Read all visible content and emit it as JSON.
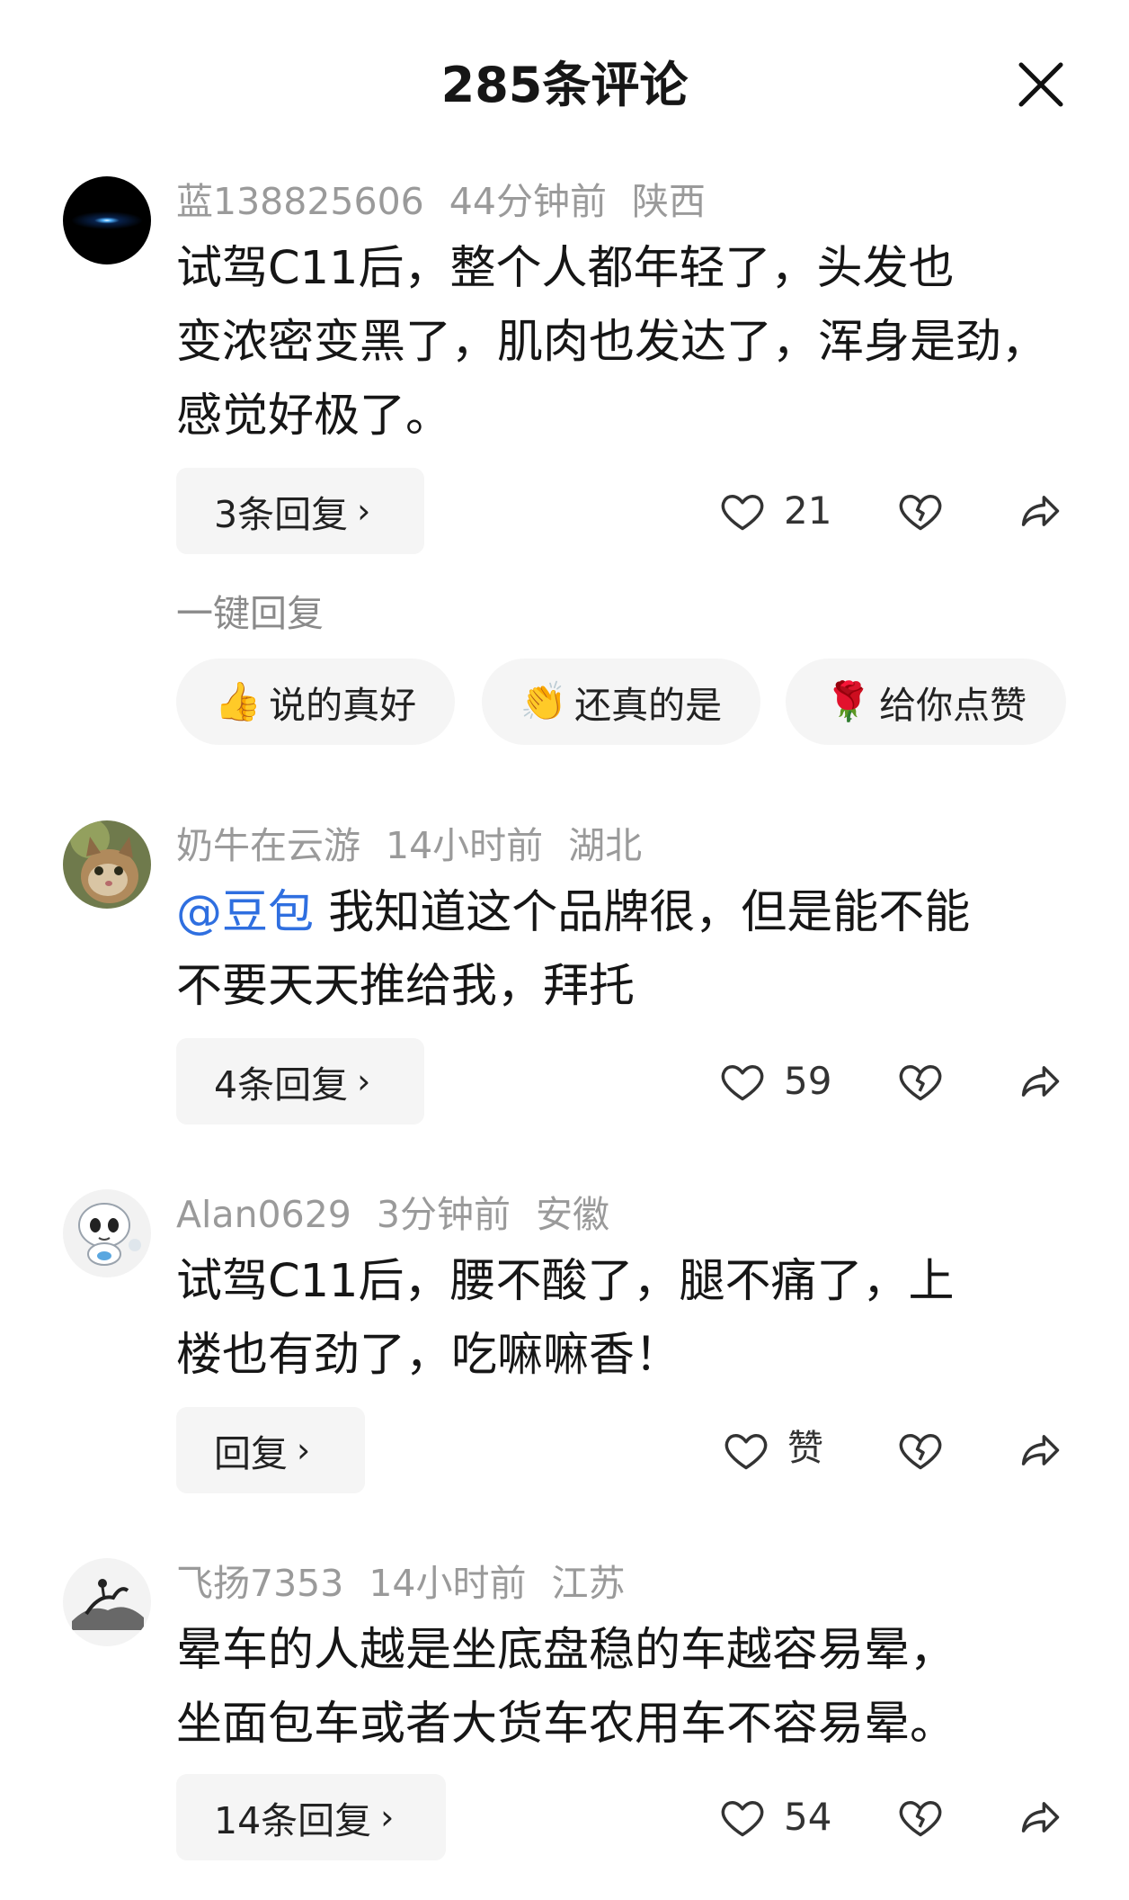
{
  "header": {
    "title": "285条评论"
  },
  "comments": [
    {
      "username": "蓝138825606",
      "time": "44分钟前",
      "location": "陕西",
      "text_lines": [
        "试驾C11后，整个人都年轻了，头发也",
        "变浓密变黑了，肌肉也发达了，浑身是劲，",
        "感觉好极了。"
      ],
      "reply_label": "3条回复",
      "likes": "21"
    },
    {
      "username": "奶牛在云游",
      "time": "14小时前",
      "location": "湖北",
      "mention": "@豆包",
      "text_lines": [
        " 我知道这个品牌很，但是能不能",
        "不要天天推给我，拜托"
      ],
      "reply_label": "4条回复",
      "likes": "59"
    },
    {
      "username": "Alan0629",
      "time": "3分钟前",
      "location": "安徽",
      "text_lines": [
        "试驾C11后，腰不酸了，腿不痛了，上",
        "楼也有劲了，吃嘛嘛香！"
      ],
      "reply_label": "回复",
      "likes": "赞"
    },
    {
      "username": "飞扬7353",
      "time": "14小时前",
      "location": "江苏",
      "text_lines": [
        "晕车的人越是坐底盘稳的车越容易晕，",
        "坐面包车或者大货车农用车不容易晕。"
      ],
      "reply_label": "14条回复",
      "likes": "54"
    }
  ],
  "quick_reply": {
    "label": "一键回复",
    "chips": [
      {
        "emoji": "👍",
        "text": "说的真好"
      },
      {
        "emoji": "👏",
        "text": "还真的是"
      },
      {
        "emoji": "🌹",
        "text": "给你点赞"
      }
    ]
  },
  "icons": {
    "close": "close-icon",
    "like": "heart-icon",
    "dislike": "broken-heart-icon",
    "share": "share-arrow-icon"
  },
  "colors": {
    "mention": "#2f6fe0",
    "meta": "#9a9a9a"
  }
}
